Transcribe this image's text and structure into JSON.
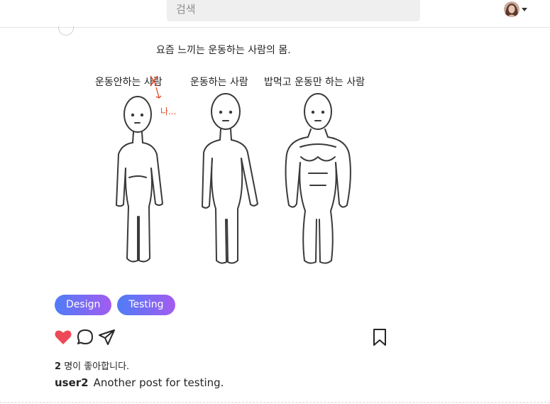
{
  "header": {
    "search_placeholder": "검색",
    "profile_menu": "profile-dropdown"
  },
  "post": {
    "image": {
      "title": "요즘 느끼는 운동하는 사람의 몸.",
      "labels": [
        "운동안하는 사람",
        "운동하는 사람",
        "밥먹고 운동만 하는 사람"
      ],
      "annotation": "나..."
    },
    "tags": [
      "Design",
      "Testing"
    ],
    "liked": true,
    "like_count": "2",
    "likes_suffix": "명이 좋아합니다.",
    "author": "user2",
    "caption": "Another post for testing."
  },
  "colors": {
    "tag_gradient_start": "#4f7cf7",
    "tag_gradient_end": "#a35cf0",
    "like_red": "#ed4956",
    "annotation_red": "#e04a2a"
  },
  "icons": [
    "heart-icon",
    "comment-icon",
    "share-icon",
    "bookmark-icon",
    "caret-down-icon"
  ]
}
